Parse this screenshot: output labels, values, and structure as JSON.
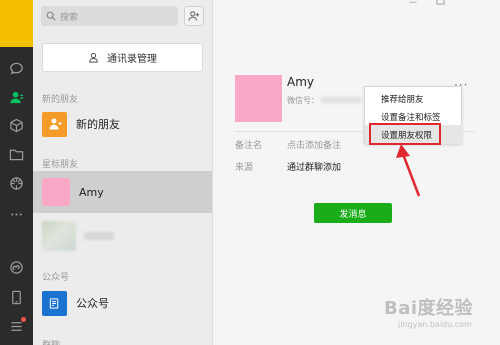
{
  "search": {
    "placeholder": "搜索"
  },
  "contacts": {
    "manage_label": "通讯录管理",
    "sections": {
      "new_friends": "新的朋友",
      "starred": "星标朋友",
      "official": "公众号",
      "groups": "群聊"
    },
    "rows": {
      "new_friends_label": "新的朋友",
      "amy_label": "Amy",
      "official_label": "公众号"
    }
  },
  "profile": {
    "name": "Amy",
    "wechat_id_label": "微信号：",
    "remark_label": "备注名",
    "remark_value": "点击添加备注",
    "source_label": "来源",
    "source_value": "通过群聊添加",
    "more_label": "···",
    "send_label": "发消息"
  },
  "context_menu": {
    "items": [
      "推荐给朋友",
      "设置备注和标签",
      "设置朋友权限"
    ]
  },
  "window": {
    "minimize": "－"
  },
  "watermark": {
    "logo": "Bai度经验",
    "url": "jingyan.baidu.com"
  },
  "colors": {
    "accent_green": "#07c160",
    "send_button": "#1aad19",
    "avatar_pink": "#f9a8c8",
    "highlight_red": "#e0282f",
    "user_avatar": "#f5c000"
  }
}
